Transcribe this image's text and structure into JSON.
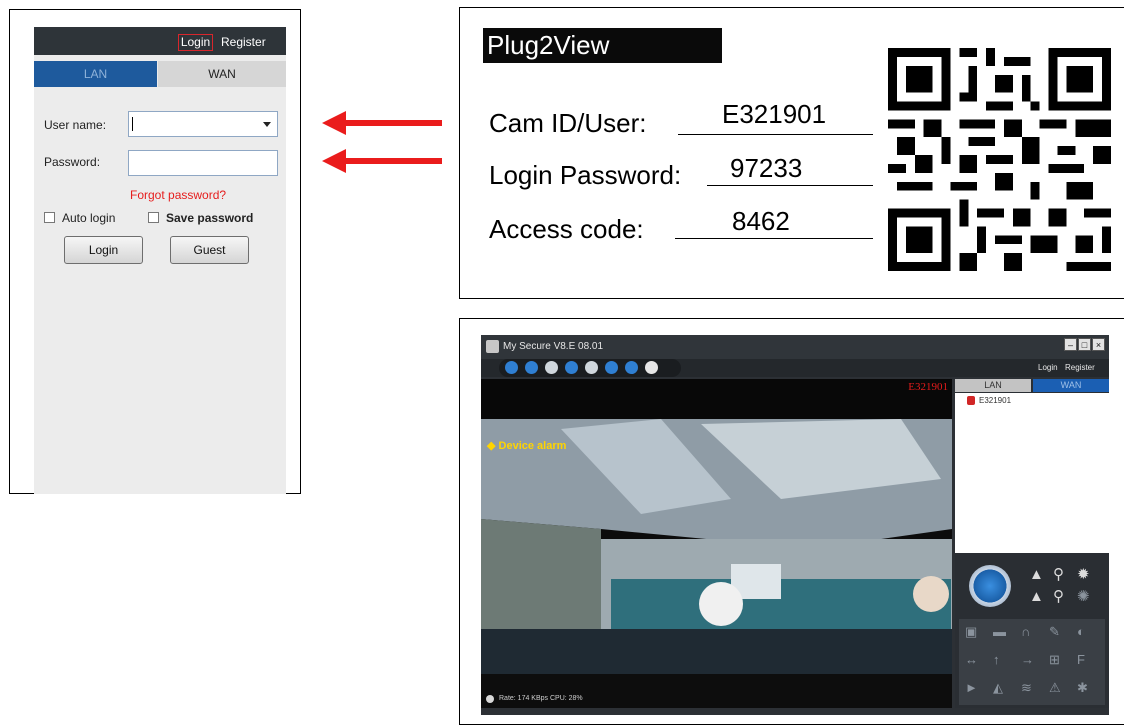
{
  "login_panel": {
    "top_login": "Login",
    "top_register": "Register",
    "tab_lan": "LAN",
    "tab_wan": "WAN",
    "username_label": "User name:",
    "username_value": "",
    "password_label": "Password:",
    "password_value": "",
    "forgot_password": "Forgot password?",
    "auto_login": "Auto login",
    "save_password": "Save password",
    "login_button": "Login",
    "guest_button": "Guest"
  },
  "camera_label": {
    "brand": "Plug2View",
    "cam_id_label": "Cam ID/User:",
    "cam_id_value": "E321901",
    "login_password_label": "Login Password:",
    "login_password_value": "97233",
    "access_code_label": "Access code:",
    "access_code_value": "8462"
  },
  "app_window": {
    "title": "My Secure  V8.E 08.01",
    "login": "Login",
    "register": "Register",
    "camera_overlay": "E321901",
    "device_alarm": "◆ Device alarm",
    "side_tab_lan": "LAN",
    "side_tab_wan": "WAN",
    "device_item": "E321901",
    "status": "Rate: 174 KBps  CPU:  28%"
  },
  "colors": {
    "arrow": "#ea1c1c",
    "lan_tab": "#1e5a9d",
    "forgot": "#e61d1d"
  }
}
